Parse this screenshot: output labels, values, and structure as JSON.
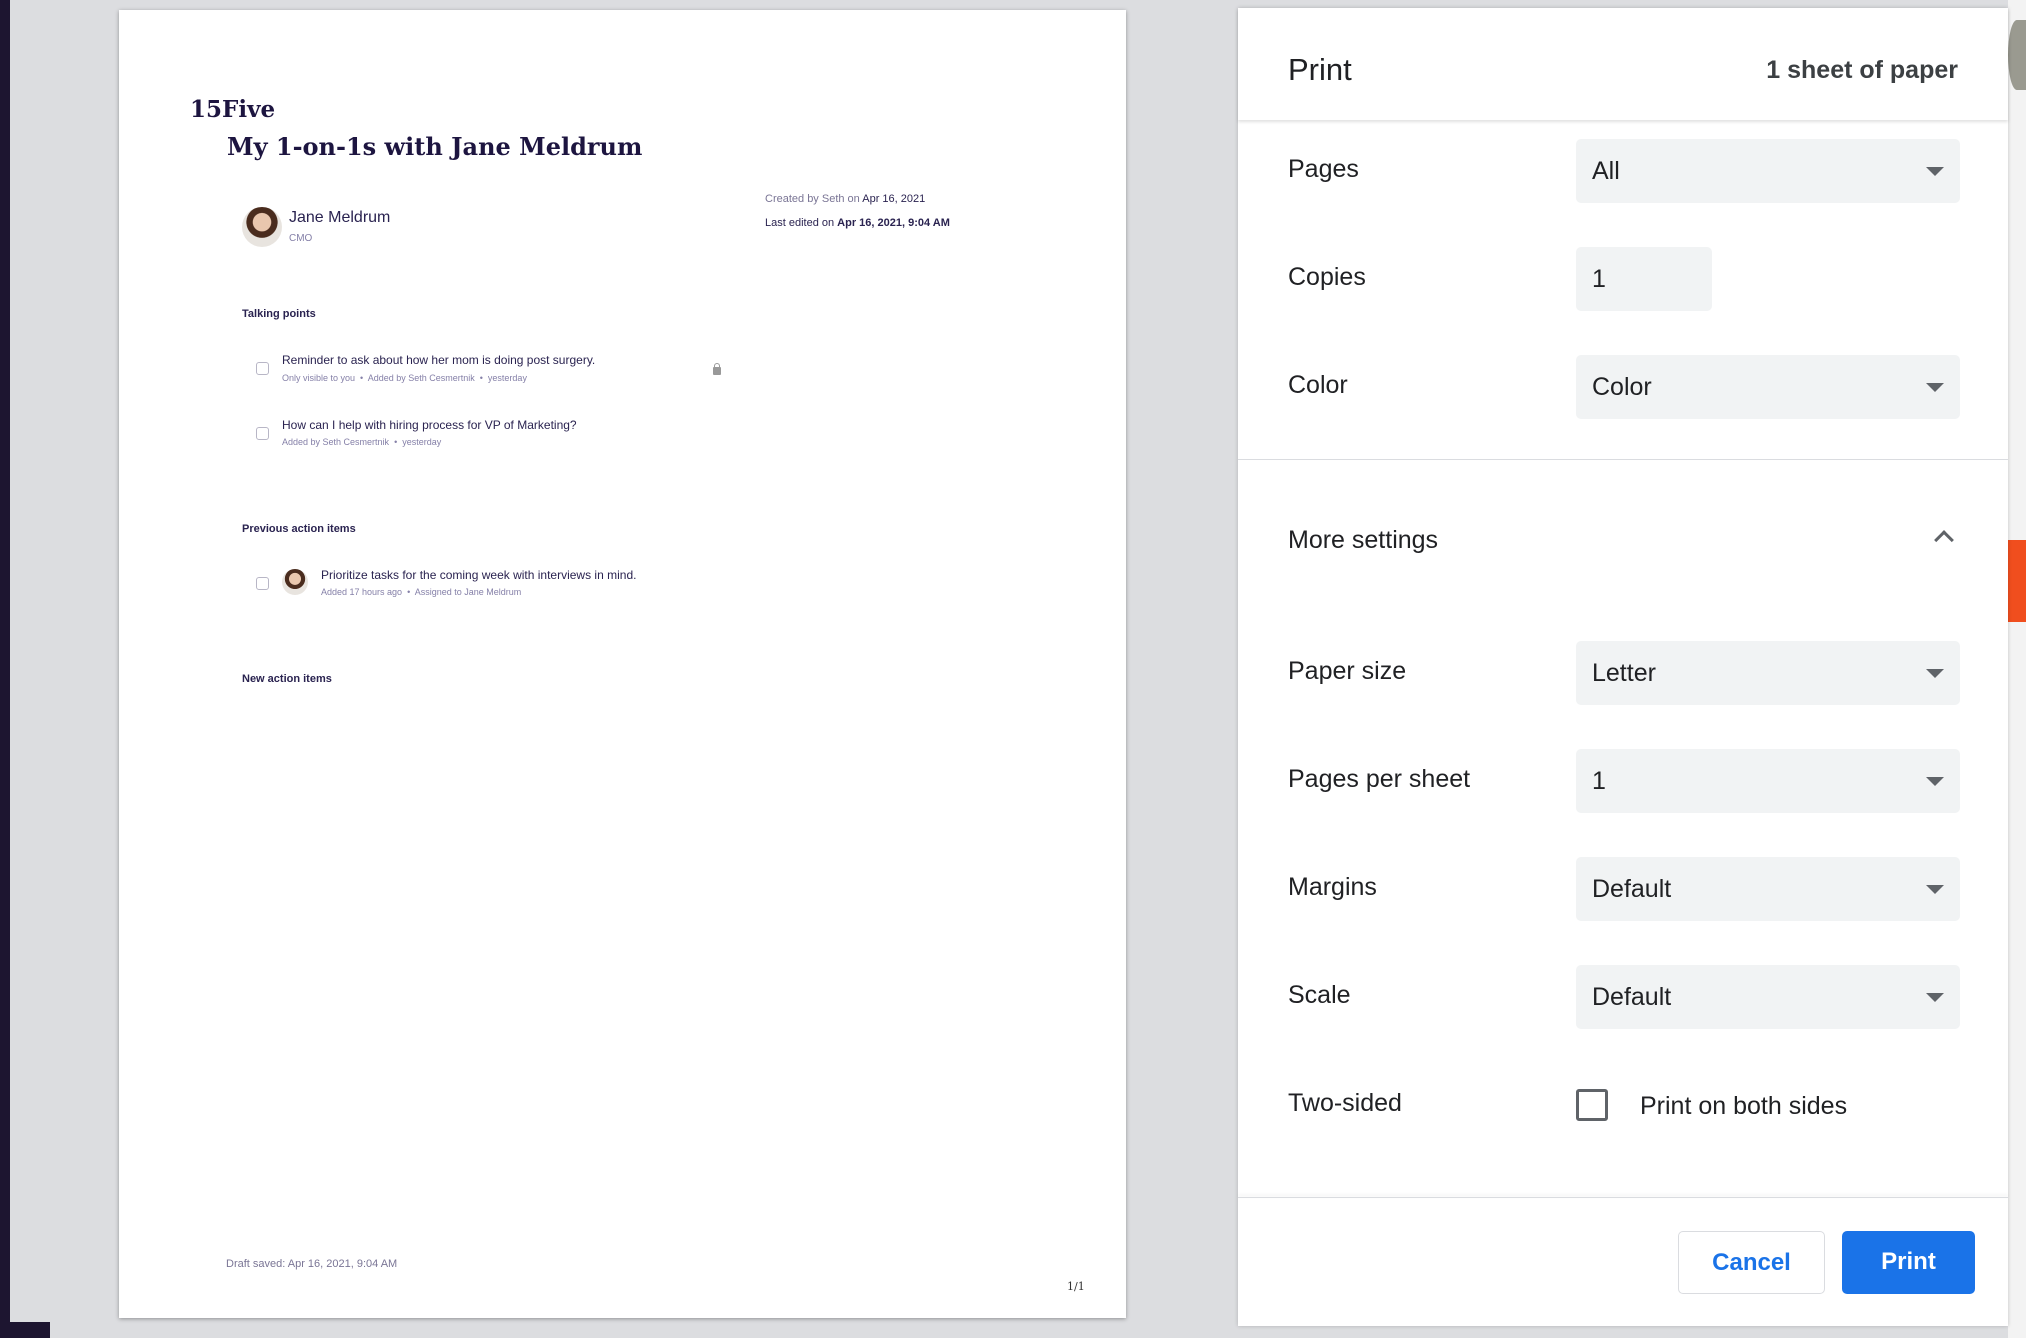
{
  "document": {
    "brand": "15Five",
    "title": "My 1-on-1s with Jane Meldrum",
    "person": {
      "name": "Jane Meldrum",
      "role": "CMO"
    },
    "created_prefix": "Created by Seth on ",
    "created_date": "Apr 16, 2021",
    "edited_prefix": "Last edited on ",
    "edited_date": "Apr 16, 2021, 9:04 AM",
    "talking_points_heading": "Talking points",
    "talking_points": [
      {
        "text": "Reminder to ask about how her mom is doing post surgery.",
        "meta": [
          "Only visible to you",
          "Added by Seth Cesmertnik",
          "yesterday"
        ],
        "private": true
      },
      {
        "text": "How can I help with hiring process for VP of Marketing?",
        "meta": [
          "Added by Seth Cesmertnik",
          "yesterday"
        ]
      }
    ],
    "previous_heading": "Previous action items",
    "previous_items": [
      {
        "text": "Prioritize tasks for the coming week with interviews in mind.",
        "meta": [
          "Added 17 hours ago",
          "Assigned to Jane Meldrum"
        ]
      }
    ],
    "new_heading": "New action items",
    "draft_saved": "Draft saved: Apr 16, 2021, 9:04 AM",
    "page_number": "1/1"
  },
  "print": {
    "title": "Print",
    "sheets": "1 sheet of paper",
    "pages": {
      "label": "Pages",
      "value": "All"
    },
    "copies": {
      "label": "Copies",
      "value": "1"
    },
    "color": {
      "label": "Color",
      "value": "Color"
    },
    "more_settings": "More settings",
    "paper_size": {
      "label": "Paper size",
      "value": "Letter"
    },
    "pages_per_sheet": {
      "label": "Pages per sheet",
      "value": "1"
    },
    "margins": {
      "label": "Margins",
      "value": "Default"
    },
    "scale": {
      "label": "Scale",
      "value": "Default"
    },
    "two_sided": {
      "label": "Two-sided",
      "option": "Print on both sides",
      "checked": false
    },
    "cancel": "Cancel",
    "print": "Print",
    "accent": "#1a73e8"
  }
}
